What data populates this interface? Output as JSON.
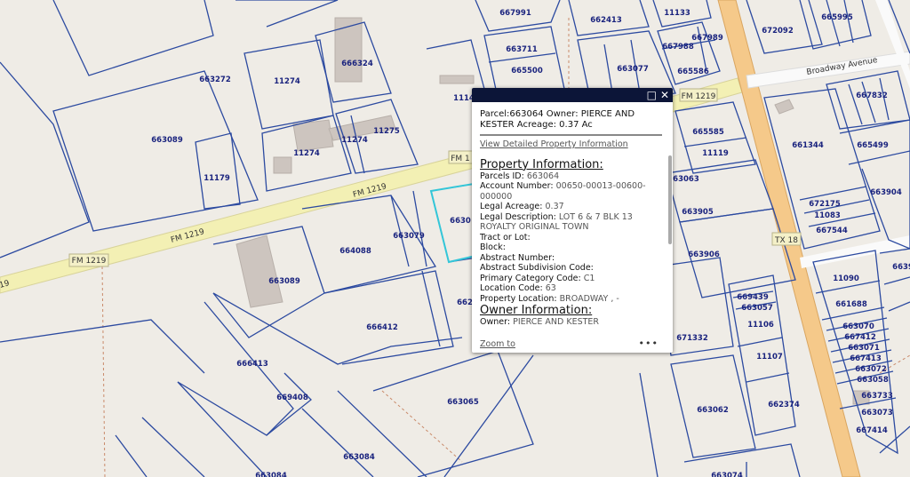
{
  "map": {
    "roads": {
      "fm1219": "FM 1219",
      "fm1219_cut": "FM 1",
      "tx18": "TX 18",
      "broadway": "Broadway Avenue",
      "fm1219_left_edge": "19"
    },
    "parcels": [
      "667991",
      "662413",
      "11133",
      "665995",
      "672092",
      "663711",
      "667988",
      "667989",
      "666324",
      "665500",
      "663077",
      "665586",
      "663272",
      "11274",
      "11274",
      "11275",
      "11274",
      "1114",
      "667832",
      "663089",
      "665585",
      "11119",
      "661344",
      "665499",
      "11179",
      "663063",
      "663904",
      "663905",
      "672175",
      "11083",
      "667544",
      "663079",
      "664088",
      "663906",
      "663089",
      "11090",
      "669439",
      "663057",
      "661688",
      "11106",
      "666412",
      "671332",
      "663070",
      "667412",
      "663071",
      "667413",
      "11107",
      "666413",
      "669408",
      "663072",
      "663058",
      "663733",
      "663065",
      "663062",
      "662374",
      "663073",
      "667414",
      "663084",
      "663084",
      "663074",
      "6639",
      "6630",
      "662"
    ],
    "colors": {
      "parcel_line": "#2c4aa0",
      "selected": "#34c6d8",
      "fm_road": "#f3f0b4",
      "state_highway": "#f5c98a",
      "background": "#efece6"
    }
  },
  "popup": {
    "title": "Parcel:663064 Owner: PIERCE AND KESTER Acreage: 0.37 Ac",
    "detail_link": "View Detailed Property Information",
    "property_heading": "Property Information:",
    "fields": [
      {
        "k": "Parcels ID:",
        "v": "663064"
      },
      {
        "k": "Account Number:",
        "v": "00650-00013-00600-000000"
      },
      {
        "k": "Legal Acreage:",
        "v": "0.37"
      },
      {
        "k": "Legal Description:",
        "v": "LOT 6 & 7 BLK 13 ROYALTY ORIGINAL TOWN"
      },
      {
        "k": "Tract or Lot:",
        "v": ""
      },
      {
        "k": "Block:",
        "v": ""
      },
      {
        "k": "Abstract Number:",
        "v": ""
      },
      {
        "k": "Abstract Subdivision Code:",
        "v": ""
      },
      {
        "k": "Primary Category Code:",
        "v": "C1"
      },
      {
        "k": "Location Code:",
        "v": "63"
      },
      {
        "k": "Property Location:",
        "v": "BROADWAY , -"
      }
    ],
    "owner_heading": "Owner Information:",
    "owner": {
      "k": "Owner:",
      "v": "PIERCE AND KESTER"
    },
    "zoom_to": "Zoom to",
    "more": "•••",
    "icons": [
      "maximize-icon",
      "close-icon"
    ]
  }
}
